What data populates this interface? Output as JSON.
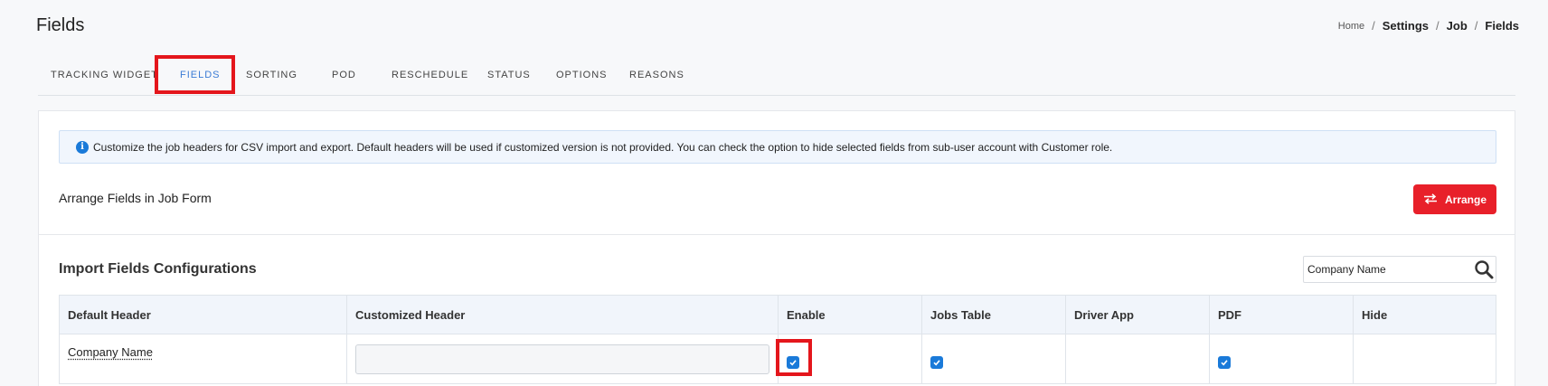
{
  "page": {
    "title": "Fields"
  },
  "breadcrumb": {
    "home": "Home",
    "items": [
      "Settings",
      "Job",
      "Fields"
    ],
    "separator": "/"
  },
  "tabs": [
    {
      "label": "TRACKING WIDGET",
      "active": false
    },
    {
      "label": "FIELDS",
      "active": true
    },
    {
      "label": "SORTING",
      "active": false
    },
    {
      "label": "POD",
      "active": false
    },
    {
      "label": "RESCHEDULE",
      "active": false
    },
    {
      "label": "STATUS",
      "active": false
    },
    {
      "label": "OPTIONS",
      "active": false
    },
    {
      "label": "REASONS",
      "active": false
    }
  ],
  "info_alert": {
    "icon": "info-icon",
    "text": "Customize the job headers for CSV import and export. Default headers will be used if customized version is not provided. You can check the option to hide selected fields from sub-user account with Customer role."
  },
  "arrange": {
    "label": "Arrange Fields in Job Form",
    "button_label": "Arrange",
    "button_icon": "swap-arrows-icon"
  },
  "import_section": {
    "title": "Import Fields Configurations",
    "search_value": "Company Name",
    "search_icon": "search-icon"
  },
  "table": {
    "headers": [
      "Default Header",
      "Customized Header",
      "Enable",
      "Jobs Table",
      "Driver App",
      "PDF",
      "Hide"
    ],
    "rows": [
      {
        "default_header": "Company Name",
        "customized_header": "",
        "enable": true,
        "jobs_table": true,
        "driver_app": false,
        "pdf": true,
        "hide": false
      }
    ]
  },
  "colors": {
    "accent": "#3a7bd5",
    "danger": "#e8202a",
    "highlight": "#e4161c",
    "checkbox": "#1a7ad9"
  }
}
